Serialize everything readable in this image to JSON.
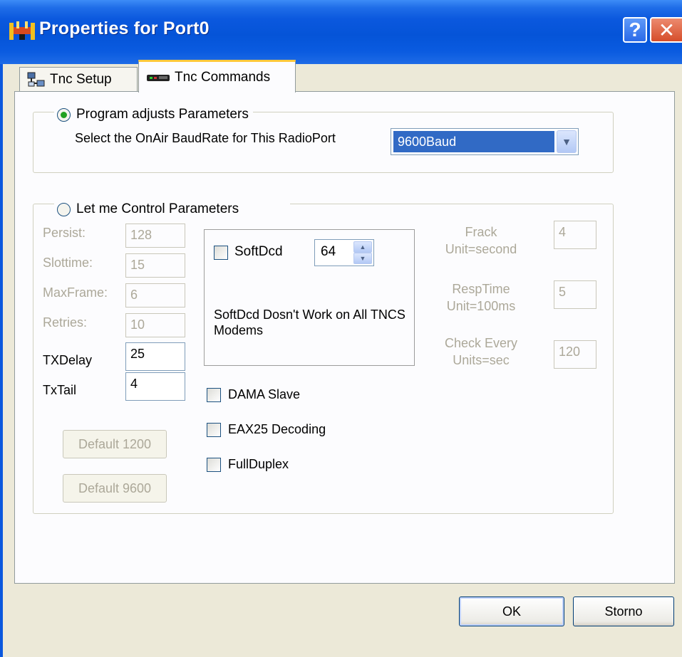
{
  "window": {
    "title": "Properties for Port0",
    "help_glyph": "?",
    "close_glyph": "✕"
  },
  "tabs": [
    {
      "label": "Tnc Setup",
      "icon": "network-setup-icon"
    },
    {
      "label": "Tnc Commands",
      "icon": "modem-device-icon"
    }
  ],
  "program_group": {
    "radio_label": "Program adjusts Parameters",
    "radio_checked": true,
    "baud_label": "Select the OnAir BaudRate for This RadioPort",
    "baud_value": "9600Baud"
  },
  "manual_group": {
    "radio_label": "Let me Control Parameters",
    "radio_checked": false,
    "params": [
      {
        "label": "Persist:",
        "value": "128",
        "enabled": false
      },
      {
        "label": "Slottime:",
        "value": "15",
        "enabled": false
      },
      {
        "label": "MaxFrame:",
        "value": "6",
        "enabled": false
      },
      {
        "label": "Retries:",
        "value": "10",
        "enabled": false
      },
      {
        "label": "TXDelay",
        "value": "25",
        "enabled": true
      },
      {
        "label": "TxTail",
        "value": "4",
        "enabled": true
      }
    ],
    "default_1200": "Default 1200",
    "default_9600": "Default 9600",
    "softdcd": {
      "label": "SoftDcd",
      "checked": false,
      "value": "64",
      "note": "SoftDcd Dosn't Work on All TNCS  Modems"
    },
    "options": [
      {
        "label": "DAMA Slave",
        "checked": false
      },
      {
        "label": "EAX25 Decoding",
        "checked": false
      },
      {
        "label": "FullDuplex",
        "checked": false
      }
    ],
    "timers": [
      {
        "label_line1": "Frack",
        "label_line2": "Unit=second",
        "value": "4"
      },
      {
        "label_line1": "RespTime",
        "label_line2": "Unit=100ms",
        "value": "5"
      },
      {
        "label_line1": "Check Every",
        "label_line2": "Units=sec",
        "value": "120"
      }
    ]
  },
  "footer": {
    "ok_label": "OK",
    "cancel_label": "Storno"
  }
}
